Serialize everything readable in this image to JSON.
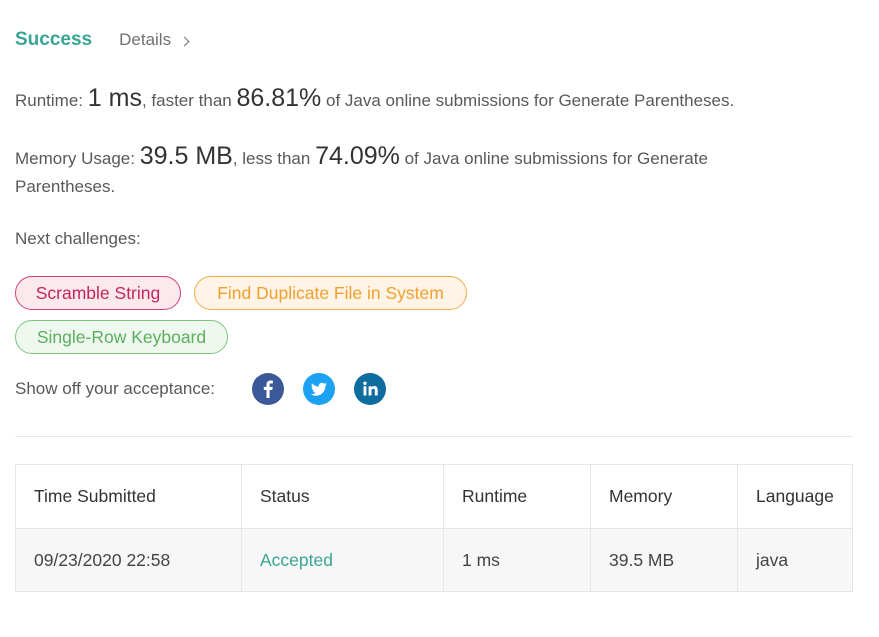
{
  "header": {
    "status": "Success",
    "details_label": "Details"
  },
  "runtime": {
    "label": "Runtime:",
    "value": "1 ms",
    "compare": ", faster than",
    "percent": "86.81%",
    "suffix": "of Java online submissions for Generate Parentheses."
  },
  "memory": {
    "label": "Memory Usage:",
    "value": "39.5 MB",
    "compare": ", less than",
    "percent": "74.09%",
    "suffix_line1": "of Java online submissions for Generate",
    "suffix_line2": "Parentheses."
  },
  "next_challenges": {
    "label": "Next challenges:",
    "items": [
      {
        "label": "Scramble String",
        "difficulty": "hard",
        "color": "#c7255a"
      },
      {
        "label": "Find Duplicate File in System",
        "difficulty": "medium",
        "color": "#f0a030"
      },
      {
        "label": "Single-Row Keyboard",
        "difficulty": "easy",
        "color": "#5cae5f"
      }
    ]
  },
  "share": {
    "label": "Show off your acceptance:",
    "icons": [
      "facebook-icon",
      "twitter-icon",
      "linkedin-icon"
    ]
  },
  "submissions": {
    "columns": [
      "Time Submitted",
      "Status",
      "Runtime",
      "Memory",
      "Language"
    ],
    "rows": [
      [
        "09/23/2020 22:58",
        "Accepted",
        "1 ms",
        "39.5 MB",
        "java"
      ]
    ]
  },
  "colors": {
    "accent": "#3aa594",
    "facebook": "#3b5998",
    "twitter": "#1da1f2",
    "linkedin": "#0e6c9f"
  }
}
